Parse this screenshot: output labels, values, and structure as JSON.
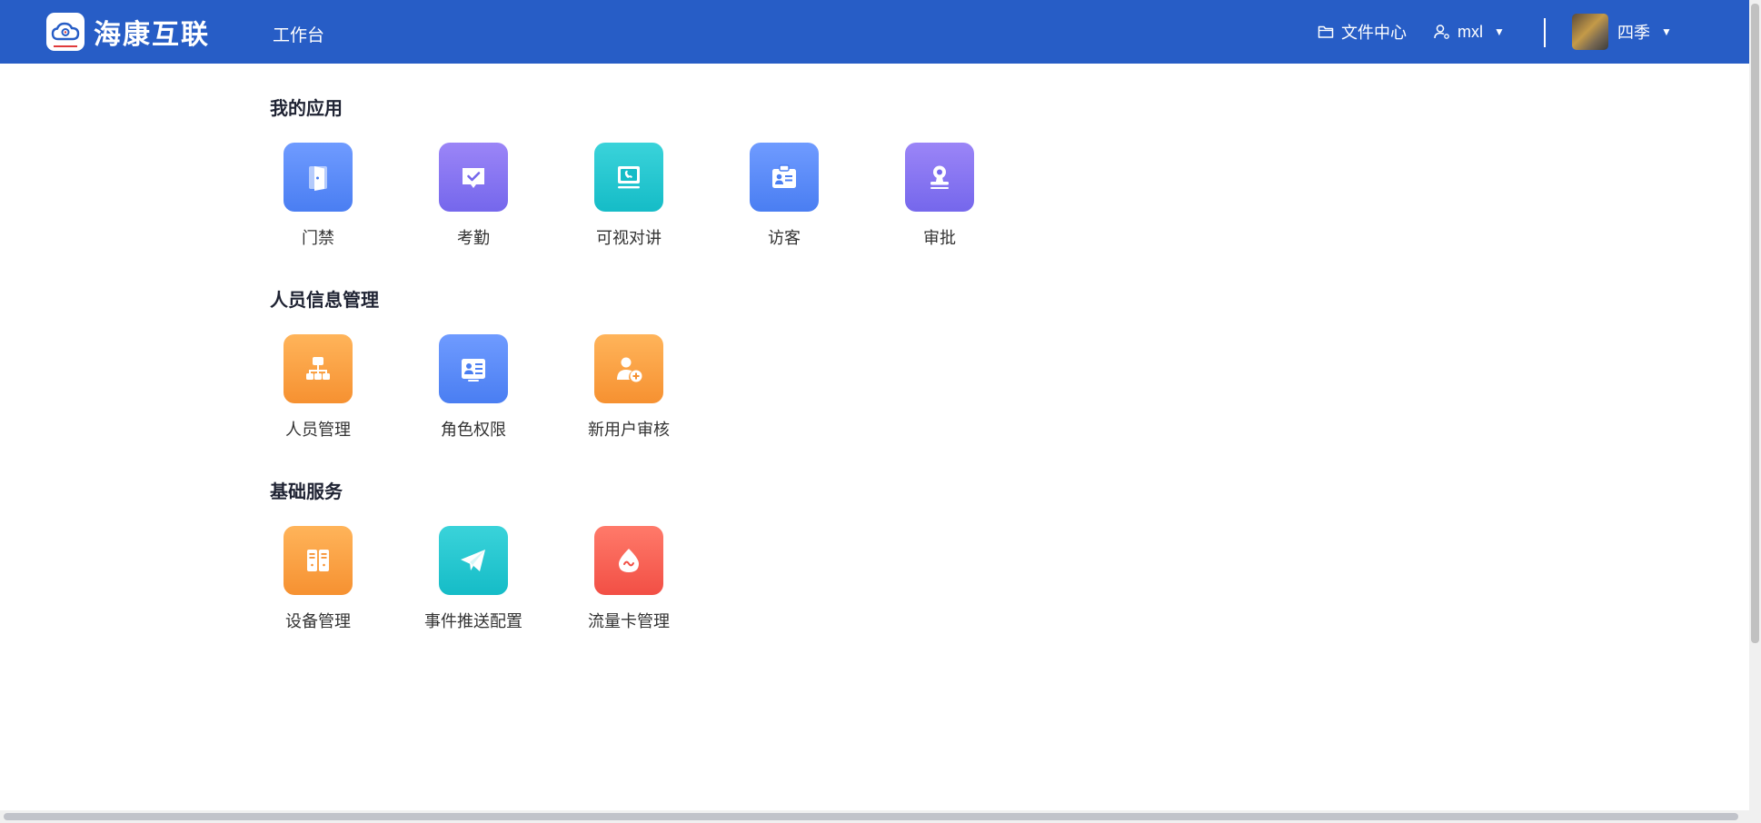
{
  "header": {
    "brand": "海康互联",
    "nav_tab": "工作台",
    "file_center": "文件中心",
    "user_name": "mxl",
    "org_name": "四季",
    "bg_color": "#275dc6"
  },
  "sections": [
    {
      "title": "我的应用",
      "apps": [
        {
          "label": "门禁",
          "icon": "door-icon",
          "color": "blue"
        },
        {
          "label": "考勤",
          "icon": "attendance-check-icon",
          "color": "purple"
        },
        {
          "label": "可视对讲",
          "icon": "video-intercom-icon",
          "color": "teal"
        },
        {
          "label": "访客",
          "icon": "visitor-badge-icon",
          "color": "blue"
        },
        {
          "label": "审批",
          "icon": "approval-stamp-icon",
          "color": "purple"
        }
      ]
    },
    {
      "title": "人员信息管理",
      "apps": [
        {
          "label": "人员管理",
          "icon": "org-chart-icon",
          "color": "orange"
        },
        {
          "label": "角色权限",
          "icon": "role-card-icon",
          "color": "blue"
        },
        {
          "label": "新用户审核",
          "icon": "user-add-icon",
          "color": "orange"
        }
      ]
    },
    {
      "title": "基础服务",
      "apps": [
        {
          "label": "设备管理",
          "icon": "device-cabinet-icon",
          "color": "orange"
        },
        {
          "label": "事件推送配置",
          "icon": "paper-plane-icon",
          "color": "teal"
        },
        {
          "label": "流量卡管理",
          "icon": "data-drop-icon",
          "color": "red"
        }
      ]
    }
  ]
}
